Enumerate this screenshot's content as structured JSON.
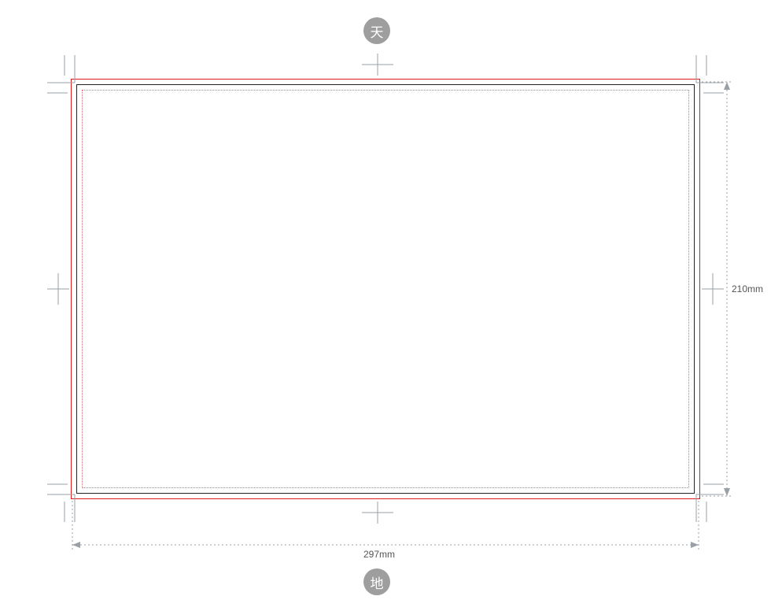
{
  "badges": {
    "top": "天",
    "bottom": "地"
  },
  "dimensions": {
    "width": "297mm",
    "height": "210mm"
  },
  "colors": {
    "trim": "#e31818",
    "cut": "#222222",
    "safe_dotted": "#e86a6a",
    "guide": "#9aa0a6",
    "badge_bg": "#9e9e9e",
    "badge_fg": "#ffffff"
  }
}
